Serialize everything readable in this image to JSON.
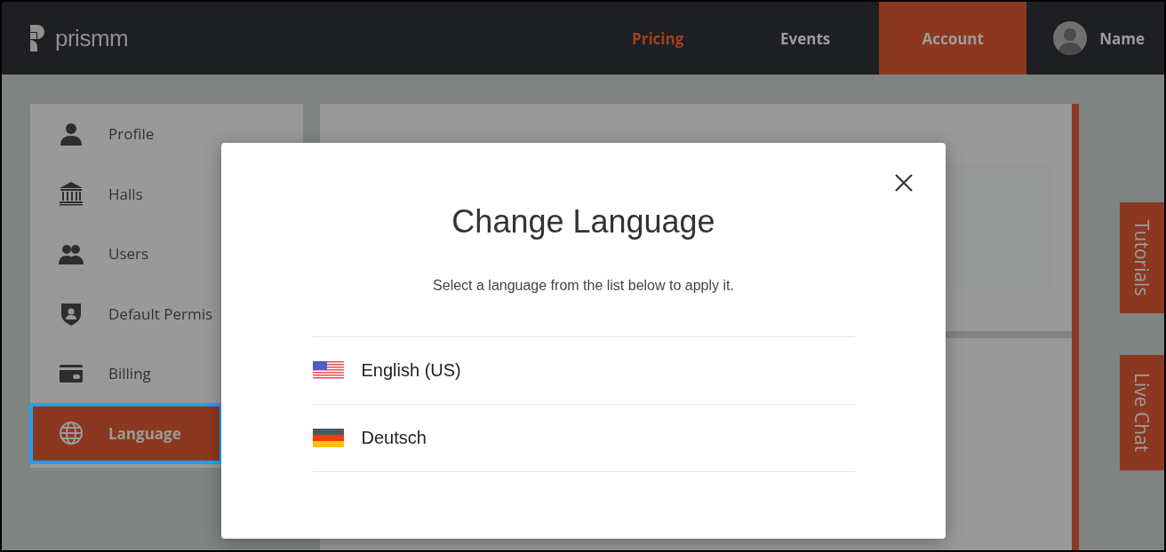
{
  "header": {
    "logo": "prismm",
    "nav": [
      {
        "label": "Pricing",
        "kind": "promo",
        "selected": false
      },
      {
        "label": "Events",
        "kind": "plain",
        "selected": false
      },
      {
        "label": "Account",
        "kind": "plain",
        "selected": true
      }
    ],
    "user": {
      "name": "Name"
    }
  },
  "sidebar": {
    "items": [
      {
        "label": "Profile",
        "kind": "person",
        "selected": false
      },
      {
        "label": "Halls",
        "kind": "bank",
        "selected": false
      },
      {
        "label": "Users",
        "kind": "users",
        "selected": false
      },
      {
        "label": "Default Permis",
        "kind": "shield",
        "selected": false
      },
      {
        "label": "Billing",
        "kind": "card",
        "selected": false
      },
      {
        "label": "Language",
        "kind": "globe",
        "selected": true
      }
    ]
  },
  "side_tabs": [
    "Tutorials",
    "Live Chat"
  ],
  "dialog": {
    "title": "Change Language",
    "message": "Select a language from the list below to apply it.",
    "languages": [
      {
        "label": "English (US)",
        "kind": "us"
      },
      {
        "label": "Deutsch",
        "kind": "de"
      }
    ]
  }
}
